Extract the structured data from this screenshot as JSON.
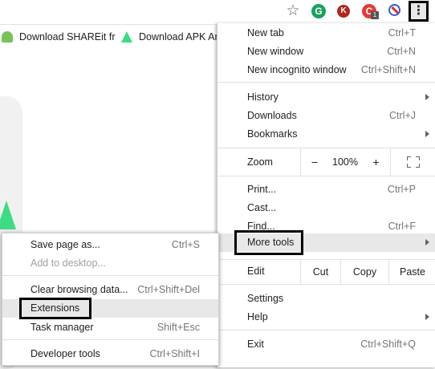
{
  "toolbar": {
    "bookmark_star": "☆",
    "extensions": [
      {
        "letter": "G",
        "color": "#1aa260",
        "name": "grammarly-extension"
      },
      {
        "letter": "K",
        "color": "#b3261e",
        "name": "k-extension"
      },
      {
        "letter": "C",
        "color": "#e53935",
        "name": "c-extension",
        "badge": "1"
      }
    ],
    "menu_button": "⋮"
  },
  "bookmarks": [
    {
      "label": "Download SHAREit fr"
    },
    {
      "label": "Download APK An"
    }
  ],
  "menu": {
    "new_tab": {
      "label": "New tab",
      "shortcut": "Ctrl+T"
    },
    "new_window": {
      "label": "New window",
      "shortcut": "Ctrl+N"
    },
    "new_incognito": {
      "label": "New incognito window",
      "shortcut": "Ctrl+Shift+N"
    },
    "history": {
      "label": "History"
    },
    "downloads": {
      "label": "Downloads",
      "shortcut": "Ctrl+J"
    },
    "bookmarks": {
      "label": "Bookmarks"
    },
    "zoom": {
      "label": "Zoom",
      "minus": "−",
      "value": "100%",
      "plus": "+"
    },
    "print": {
      "label": "Print...",
      "shortcut": "Ctrl+P"
    },
    "cast": {
      "label": "Cast..."
    },
    "find": {
      "label": "Find...",
      "shortcut": "Ctrl+F"
    },
    "more_tools": {
      "label": "More tools"
    },
    "edit": {
      "label": "Edit",
      "cut": "Cut",
      "copy": "Copy",
      "paste": "Paste"
    },
    "settings": {
      "label": "Settings"
    },
    "help": {
      "label": "Help"
    },
    "exit": {
      "label": "Exit",
      "shortcut": "Ctrl+Shift+Q"
    }
  },
  "submenu": {
    "save_page": {
      "label": "Save page as...",
      "shortcut": "Ctrl+S"
    },
    "add_desktop": {
      "label": "Add to desktop..."
    },
    "clear_data": {
      "label": "Clear browsing data...",
      "shortcut": "Ctrl+Shift+Del"
    },
    "extensions": {
      "label": "Extensions"
    },
    "task_manager": {
      "label": "Task manager",
      "shortcut": "Shift+Esc"
    },
    "dev_tools": {
      "label": "Developer tools",
      "shortcut": "Ctrl+Shift+I"
    }
  }
}
